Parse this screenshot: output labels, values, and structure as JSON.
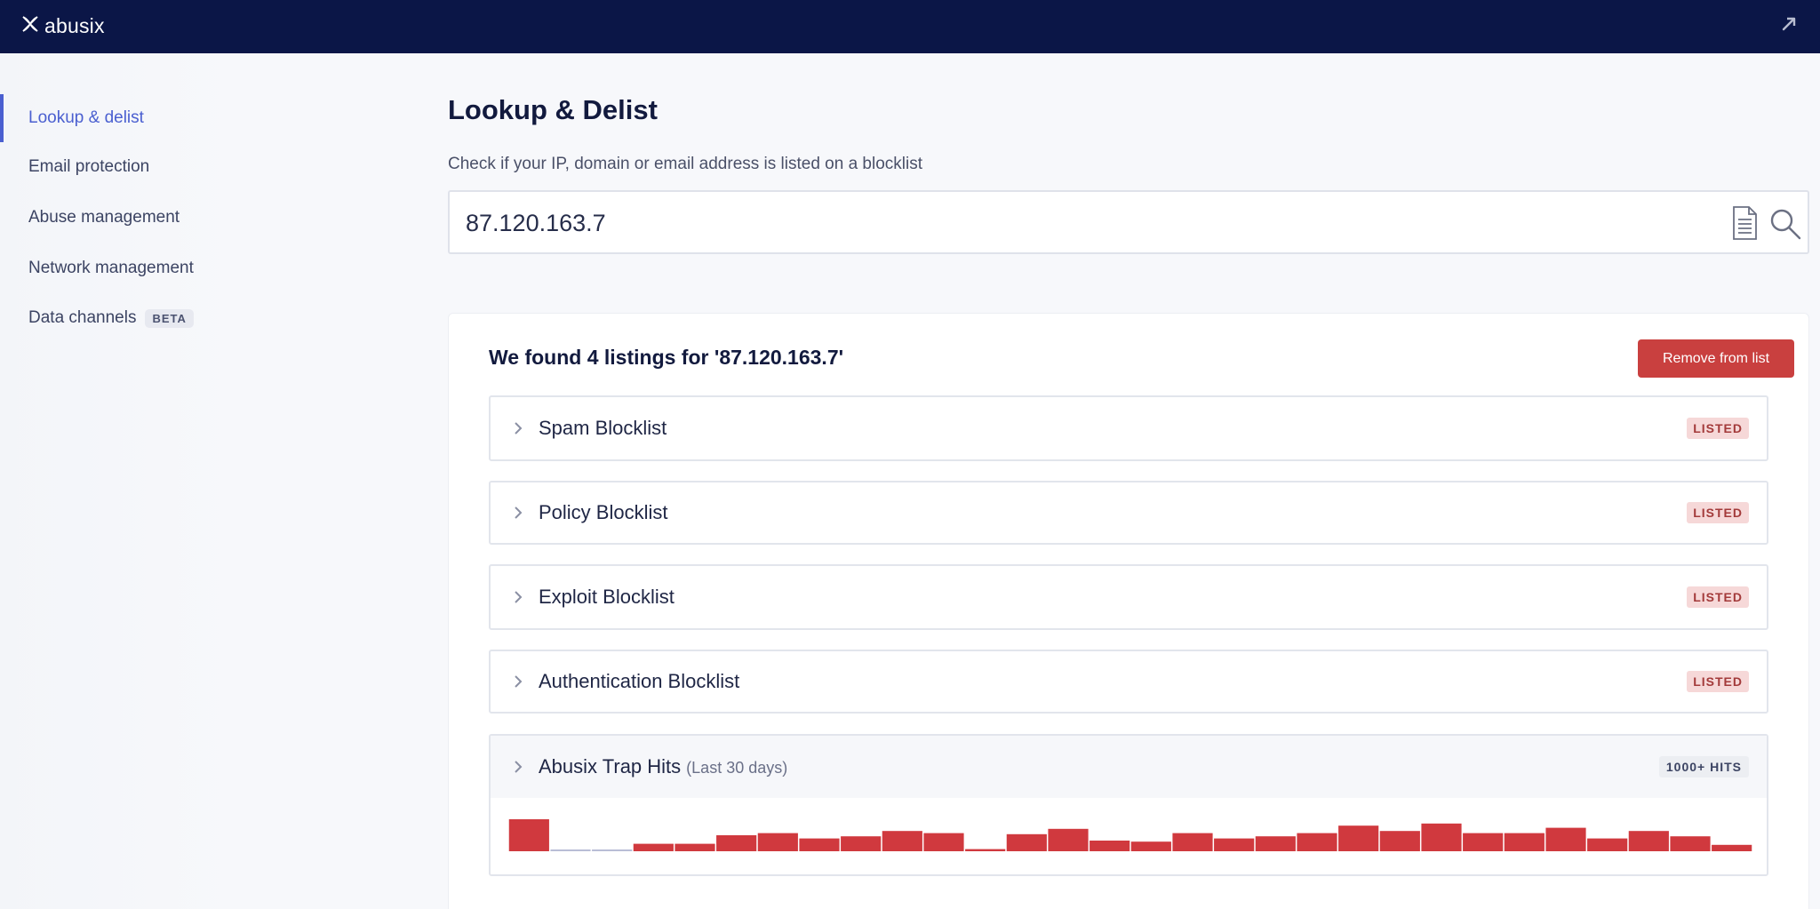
{
  "app": {
    "logo_text": "abusix"
  },
  "sidebar": {
    "items": [
      {
        "label": "Lookup & delist"
      },
      {
        "label": "Email protection"
      },
      {
        "label": "Abuse management"
      },
      {
        "label": "Network management"
      },
      {
        "label": "Data channels",
        "badge": "BETA"
      }
    ]
  },
  "main": {
    "title": "Lookup & Delist",
    "subtitle": "Check if your IP, domain or email address is listed on a blocklist",
    "search": {
      "value": "87.120.163.7"
    },
    "results": {
      "heading": "We found 4 listings for '87.120.163.7'",
      "remove_label": "Remove from list",
      "listings": [
        {
          "name": "Spam Blocklist",
          "status": "LISTED"
        },
        {
          "name": "Policy Blocklist",
          "status": "LISTED"
        },
        {
          "name": "Exploit Blocklist",
          "status": "LISTED"
        },
        {
          "name": "Authentication Blocklist",
          "status": "LISTED"
        }
      ],
      "trap": {
        "name": "Abusix Trap Hits",
        "period": "(Last 30 days)",
        "badge": "1000+ HITS"
      }
    }
  },
  "colors": {
    "topbar": "#0b1647",
    "accent": "#4a5fd0",
    "danger": "#c9403f",
    "bar_active": "#d0393e",
    "bar_empty": "#b9bdd6"
  },
  "chart_data": {
    "type": "bar",
    "categories": [],
    "values": [
      30,
      2,
      2,
      7,
      7,
      15,
      17,
      12,
      14,
      19,
      17,
      2,
      16,
      21,
      10,
      9,
      17,
      12,
      14,
      17,
      24,
      19,
      26,
      17,
      17,
      22,
      12,
      19,
      14,
      6
    ],
    "empty_indices": [
      1,
      2
    ],
    "title": "",
    "xlabel": "",
    "ylabel": "",
    "ylim": [
      0,
      30
    ],
    "grid": false,
    "legend": "none"
  }
}
